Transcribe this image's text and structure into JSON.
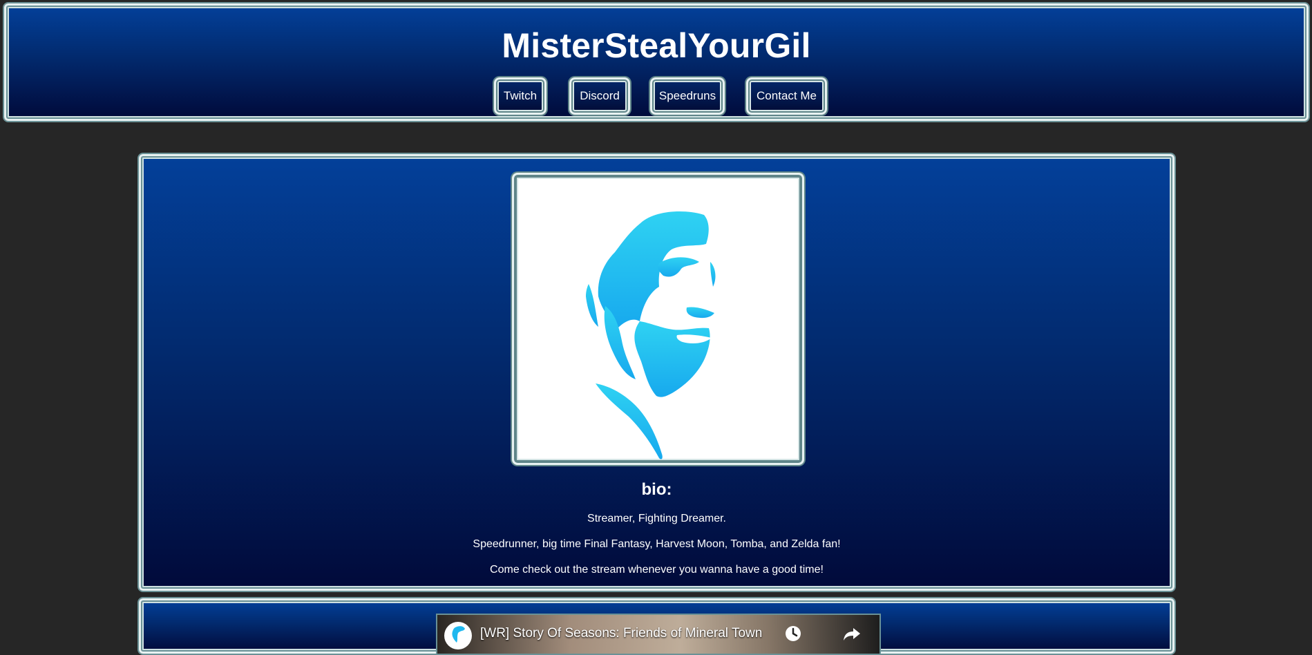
{
  "site": {
    "title": "MisterStealYourGil"
  },
  "nav": {
    "items": [
      {
        "label": "Twitch"
      },
      {
        "label": "Discord"
      },
      {
        "label": "Speedruns"
      },
      {
        "label": "Contact Me"
      }
    ]
  },
  "profile": {
    "avatar_icon": "profile-portrait-icon",
    "bio_heading": "bio:",
    "bio_lines": [
      "Streamer, Fighting Dreamer.",
      "Speedrunner, big time Final Fantasy, Harvest Moon, Tomba, and Zelda fan!",
      "Come check out the stream whenever you wanna have a good time!"
    ]
  },
  "video": {
    "title": "[WR] Story Of Seasons: Friends of Mineral Town",
    "icons": [
      "watch-later-icon",
      "share-icon"
    ]
  },
  "colors": {
    "page_background": "#262626",
    "panel_gradient_top": "#03409a",
    "panel_gradient_bottom": "#010a3a",
    "frame_border": "#e8f2f2",
    "frame_shadow": "#6a9196",
    "avatar_accent": "#1fb8ef",
    "text": "#ffffff"
  }
}
